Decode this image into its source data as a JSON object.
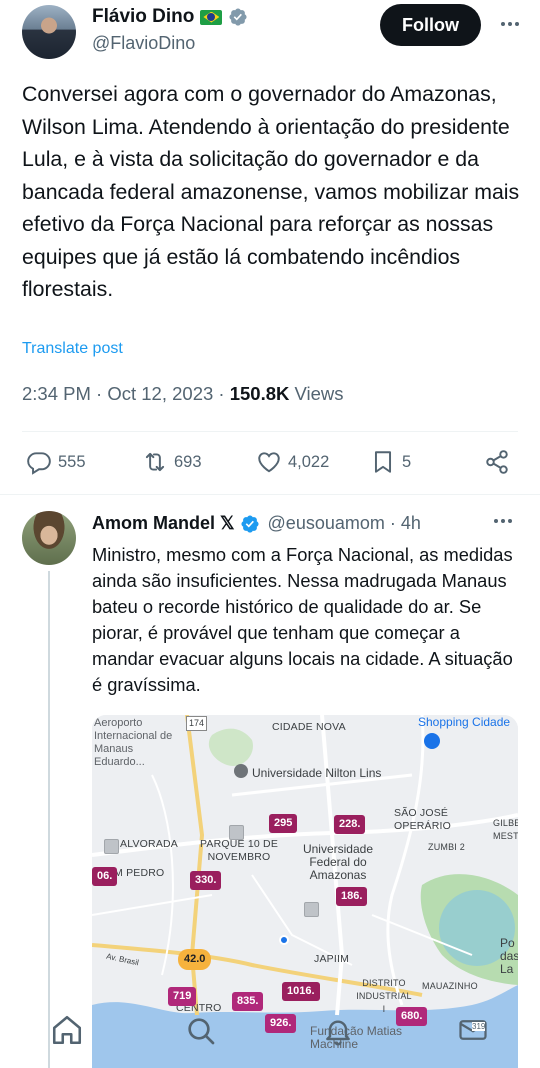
{
  "main_tweet": {
    "author_name": "Flávio Dino",
    "handle": "@FlavioDino",
    "follow_label": "Follow",
    "text": "Conversei agora com o governador do Amazonas, Wilson Lima. Atendendo à orientação do presidente Lula, e à vista da solicitação do governador e da bancada federal amazonense, vamos mobilizar mais efetivo da Força Nacional para reforçar as nossas equipes que já estão lá combatendo incêndios florestais.",
    "translate_label": "Translate post",
    "time": "2:34 PM · Oct 12, 2023 · ",
    "views_count": "150.8K",
    "views_label": " Views",
    "stats": {
      "replies": "555",
      "reposts": "693",
      "likes": "4,022",
      "bookmarks": "5"
    }
  },
  "reply": {
    "author_name": "Amom Mandel",
    "x_mark": "𝕏",
    "handle": "@eusouamom",
    "time": " · 4h",
    "text": "Ministro, mesmo com a Força Nacional, as medidas ainda são insuficientes. Nessa madrugada Manaus bateu o recorde histórico de qualidade do ar. Se piorar, é provável que tenham que começar a mandar evacuar alguns locais na cidade. A situação é gravíssima."
  },
  "map": {
    "labels": {
      "aeroporto": "Aeroporto Internacional de Manaus Eduardo...",
      "route": "174",
      "cidade_nova": "CIDADE NOVA",
      "shopping": "Shopping Cidade",
      "univ_nilton": "Universidade Nilton Lins",
      "sao_jose": "SÃO JOSÉ OPERÁRIO",
      "gilberto": "GILBE MESTR",
      "alvorada": "ALVORADA",
      "parque10": "PARQUE 10 DE NOVEMBRO",
      "ufam": "Universidade Federal do Amazonas",
      "zumbi": "ZUMBI 2",
      "sao_pedro": "M PEDRO",
      "ponta": "Po das La",
      "av_brasil": "Av. Brasil",
      "japiim": "JAPIIM",
      "distrito": "DISTRITO INDUSTRIAL I",
      "mauazinho": "MAUAZINHO",
      "centro": "CENTRO",
      "fundacao": "Fundação Matias Machline"
    },
    "aqi_markers": {
      "m295": "295",
      "m228": "228.",
      "m06": "06.",
      "m330": "330.",
      "m186": "186.",
      "m42": "42.0",
      "m719": "719",
      "m835": "835.",
      "m1016": "1016.",
      "m926": "926.",
      "m680": "680."
    }
  },
  "bottom_nav": {
    "mail_badge": "319"
  }
}
